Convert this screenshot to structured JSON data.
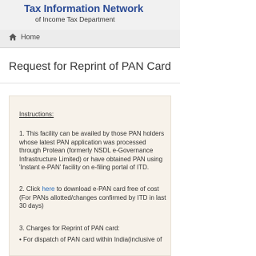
{
  "header": {
    "title": "Tax Information Network",
    "subtitle": "of Income Tax Department",
    "accent_color": "#2a4a95"
  },
  "nav": {
    "home_icon": "home-icon",
    "home_label": "Home"
  },
  "page": {
    "title": "Request for Reprint of PAN Card"
  },
  "instructions": {
    "heading": "Instructions:",
    "item1": "1. This facility can be availed by those PAN holders whose latest PAN application was processed through Protean (formerly NSDL e-Governance Infrastructure Limited) or have obtained PAN using 'Instant e-PAN' facility on e-filing portal of ITD.",
    "item2_before": "2. Click ",
    "item2_link": "here",
    "item2_after": " to download e-PAN card free of cost (For PANs allotted/changes confirmed by ITD in last 30 days)",
    "item3_heading": "3. Charges for Reprint of PAN card:",
    "item3_bullet": "• For dispatch of PAN card within India(inclusive of"
  }
}
